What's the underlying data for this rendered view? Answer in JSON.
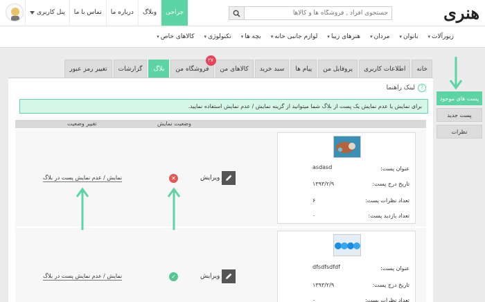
{
  "header": {
    "logo_text": "هنری",
    "search_placeholder": "جستجوی افراد , فروشگاه ها و کالاها",
    "nav": [
      {
        "label": "جراحی",
        "active": true
      },
      {
        "label": "وبلاگ",
        "active": false
      },
      {
        "label": "درباره ما",
        "active": false
      },
      {
        "label": "تماس با ما",
        "active": false
      }
    ],
    "user_panel_label": "پنل کاربری"
  },
  "categories": [
    "زیورآلات",
    "بانوان",
    "مردان",
    "هنرهای زیبا",
    "لوازم جانبی خانه",
    "بچه ها",
    "تکنولوژی",
    "کالاهای خاص"
  ],
  "tabs": [
    {
      "label": "خانه",
      "active": false
    },
    {
      "label": "اطلاعات کاربری",
      "active": false
    },
    {
      "label": "پروفایل من",
      "active": false
    },
    {
      "label": "پیام ها",
      "active": false
    },
    {
      "label": "سبد خرید",
      "active": false
    },
    {
      "label": "کالاهای من",
      "active": false
    },
    {
      "label": "فروشگاه من",
      "active": false,
      "badge": "۲۷"
    },
    {
      "label": "بلاگ",
      "active": true
    },
    {
      "label": "گزارشات",
      "active": false
    },
    {
      "label": "تغییر رمز عبور",
      "active": false
    }
  ],
  "help_label": "لینک راهنما",
  "notice_text": "برای نمایش یا عدم نمایش یک پست از بلاگ شما میتوانید از گزینه نمایش / عدم نمایش استفاده نمایید.",
  "table": {
    "headers": {
      "status": "وضعیت نمایش",
      "change": "تغییر وضعیت"
    },
    "rows": [
      {
        "title_label": "عنوان پست:",
        "title_value": "asdasd",
        "date_label": "تاریخ درج پست:",
        "date_value": "۱۳۹۳/۲/۹",
        "comments_label": "تعداد نظرات پست:",
        "comments_value": "۶",
        "views_label": "تعداد بازدید پست:",
        "views_value": "۰",
        "edit_label": "ویرایش",
        "status": "hidden",
        "toggle_label": "نمایش / عدم نمایش پست در بلاگ"
      },
      {
        "title_label": "عنوان پست:",
        "title_value": "dfsdfsdfdf",
        "date_label": "تاریخ درج پست:",
        "date_value": "۱۳۹۳/۲/۹",
        "comments_label": "تعداد نظرات پست:",
        "comments_value": "۰",
        "edit_label": "ویرایش",
        "status": "visible",
        "toggle_label": "نمایش / عدم نمایش پست در بلاگ"
      }
    ]
  },
  "side_menu": [
    {
      "label": "پست های موجود",
      "active": true
    },
    {
      "label": "پست جدید",
      "active": false
    },
    {
      "label": "نظرات",
      "active": false
    }
  ],
  "colors": {
    "accent": "#5dd4a3",
    "badge": "#e8445a",
    "error": "#e25757",
    "success": "#55c795"
  }
}
